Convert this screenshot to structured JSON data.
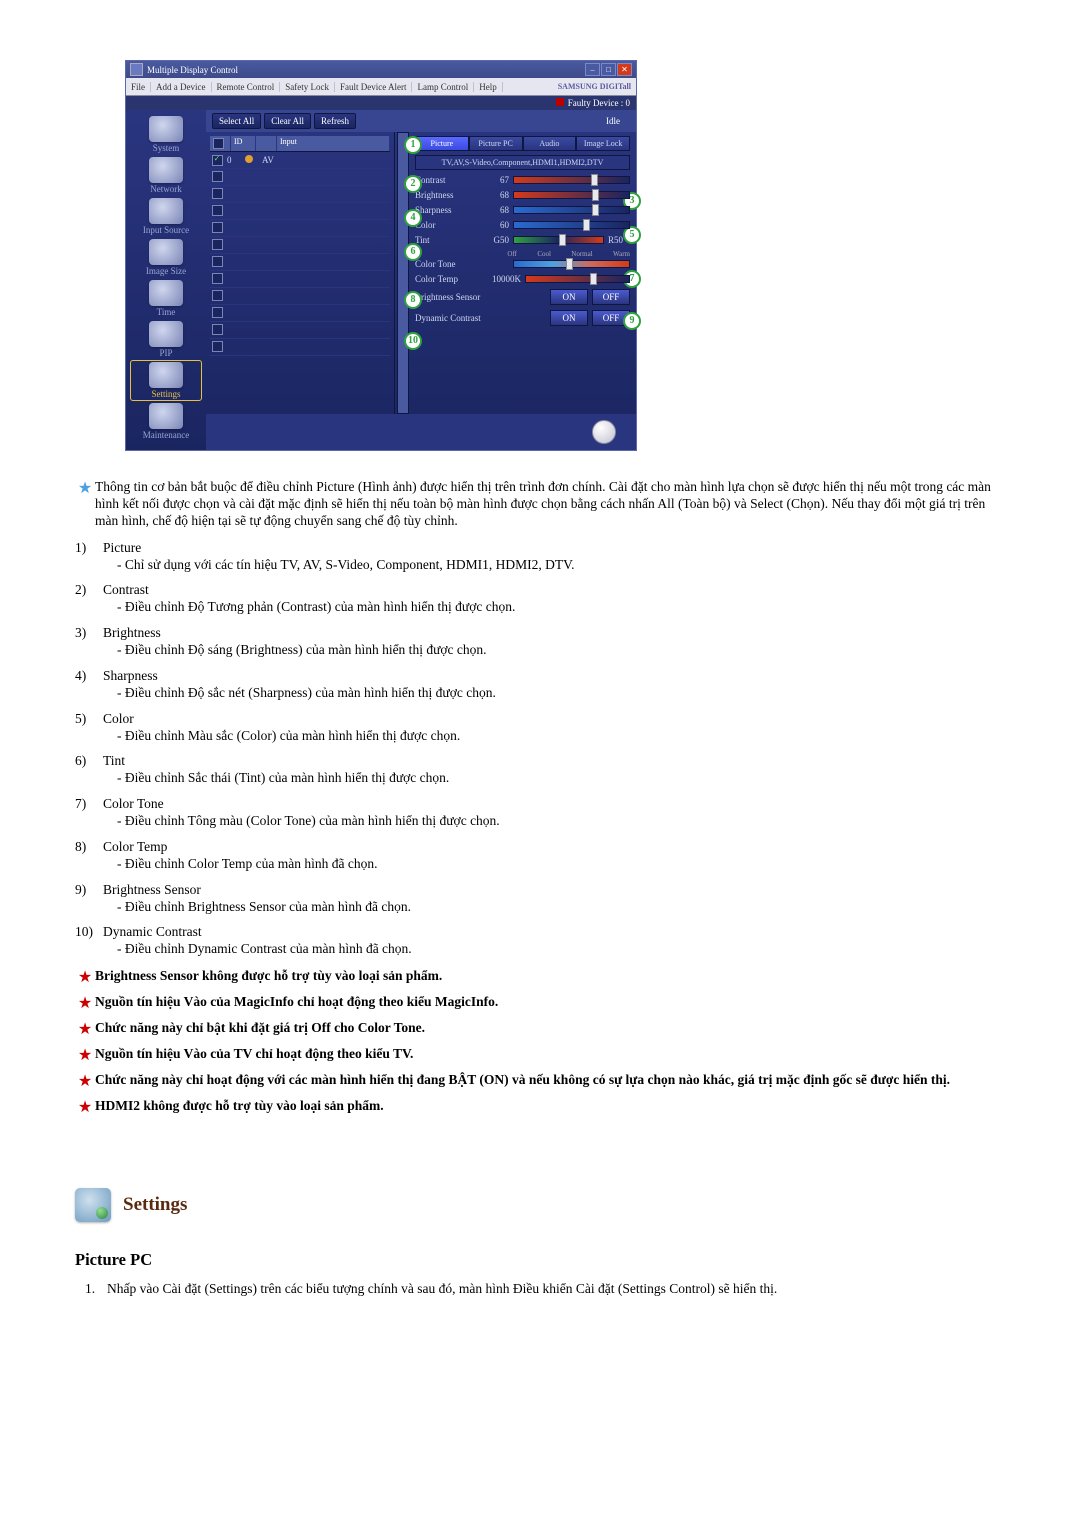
{
  "app": {
    "title": "Multiple Display Control",
    "menu": [
      "File",
      "Add a Device",
      "Remote Control",
      "Safety Lock",
      "Fault Device Alert",
      "Lamp Control",
      "Help"
    ],
    "brand": "SAMSUNG DIGITall",
    "status": "Faulty Device : 0",
    "toolbar": {
      "select_all": "Select All",
      "clear_all": "Clear All",
      "refresh": "Refresh",
      "idle": "Idle"
    },
    "sidebar": [
      "System",
      "Network",
      "Input Source",
      "Image Size",
      "Time",
      "PIP",
      "Settings",
      "Maintenance"
    ],
    "active_sidebar_index": 6,
    "table": {
      "headers": {
        "id": "ID",
        "input": "Input"
      },
      "row0": {
        "id": "0",
        "input": "AV"
      }
    },
    "tabs": [
      "Picture",
      "Picture PC",
      "Audio",
      "Image Lock"
    ],
    "signals": "TV,AV,S-Video,Component,HDMI1,HDMI2,DTV",
    "settings": {
      "contrast": {
        "label": "Contrast",
        "value": "67"
      },
      "brightness": {
        "label": "Brightness",
        "value": "68"
      },
      "sharpness": {
        "label": "Sharpness",
        "value": "68"
      },
      "color": {
        "label": "Color",
        "value": "60"
      },
      "tint": {
        "label": "Tint",
        "left": "G50",
        "right": "R50"
      },
      "color_tone": {
        "label": "Color Tone",
        "opts": [
          "Off",
          "Cool",
          "Normal",
          "Warm"
        ]
      },
      "color_temp": {
        "label": "Color Temp",
        "value": "10000K"
      },
      "brightness_sensor": {
        "label": "Brightness Sensor",
        "on": "ON",
        "off": "OFF"
      },
      "dynamic_contrast": {
        "label": "Dynamic Contrast",
        "on": "ON",
        "off": "OFF"
      }
    }
  },
  "doc": {
    "intro_note": "Thông tin cơ bản bắt buộc để điều chỉnh Picture (Hình ảnh) được hiển thị trên trình đơn chính. Cài đặt cho màn hình lựa chọn sẽ được hiển thị nếu một trong các màn hình kết nối được chọn và cài đặt mặc định sẽ hiển thị nếu toàn bộ màn hình được chọn bằng cách nhấn All (Toàn bộ) và Select (Chọn). Nếu thay đổi một giá trị trên màn hình, chế độ hiện tại sẽ tự động chuyển sang chế độ tùy chỉnh.",
    "items": [
      {
        "n": "1)",
        "title": "Picture",
        "sub": "- Chỉ sử dụng với các tín hiệu TV, AV, S-Video, Component, HDMI1, HDMI2, DTV."
      },
      {
        "n": "2)",
        "title": "Contrast",
        "sub": "- Điều chỉnh Độ Tương phản (Contrast) của màn hình hiển thị được chọn."
      },
      {
        "n": "3)",
        "title": "Brightness",
        "sub": "- Điều chỉnh Độ sáng (Brightness) của màn hình hiển thị được chọn."
      },
      {
        "n": "4)",
        "title": "Sharpness",
        "sub": "- Điều chỉnh Độ sắc nét (Sharpness) của màn hình hiển thị được chọn."
      },
      {
        "n": "5)",
        "title": "Color",
        "sub": "- Điều chỉnh Màu sắc (Color) của màn hình hiển thị được chọn."
      },
      {
        "n": "6)",
        "title": "Tint",
        "sub": "- Điều chỉnh Sắc thái (Tint) của màn hình hiển thị được chọn."
      },
      {
        "n": "7)",
        "title": "Color Tone",
        "sub": "- Điều chỉnh Tông màu (Color Tone) của màn hình hiển thị được chọn."
      },
      {
        "n": "8)",
        "title": "Color Temp",
        "sub": "- Điều chỉnh Color Temp của màn hình đã chọn."
      },
      {
        "n": "9)",
        "title": "Brightness Sensor",
        "sub": "- Điều chỉnh Brightness Sensor của màn hình đã chọn."
      },
      {
        "n": "10)",
        "title": "Dynamic Contrast",
        "sub": "- Điều chỉnh Dynamic Contrast của màn hình đã chọn."
      }
    ],
    "notes": [
      "Brightness Sensor không được hỗ trợ tùy vào loại sản phẩm.",
      "Nguồn tín hiệu Vào của MagicInfo chỉ hoạt động theo kiểu MagicInfo.",
      "Chức năng này chỉ bật khi đặt giá trị Off cho Color Tone.",
      "Nguồn tín hiệu Vào của TV chỉ hoạt động theo kiểu TV.",
      "Chức năng này chỉ hoạt động với các màn hình hiển thị đang BẬT (ON) và nếu không có sự lựa chọn nào khác, giá trị mặc định gốc sẽ được hiển thị.",
      "HDMI2 không được hỗ trợ tùy vào loại sản phẩm."
    ],
    "section_title": "Settings",
    "subsection_title": "Picture PC",
    "step1_n": "1.",
    "step1": "Nhấp vào Cài đặt (Settings) trên các biểu tượng chính và sau đó, màn hình Điều khiển Cài đặt (Settings Control) sẽ hiển thị."
  }
}
